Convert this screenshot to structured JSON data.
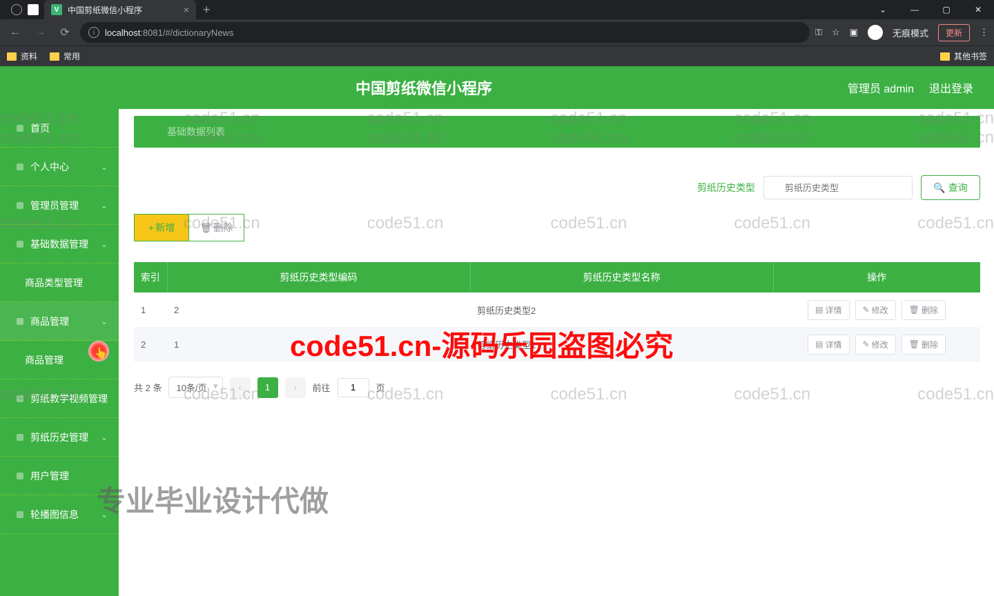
{
  "browser": {
    "tab_favicon": "V",
    "tab_title": "中国剪纸微信小程序",
    "url_host": "localhost",
    "url_rest": ":8081/#/dictionaryNews",
    "incognito": "无痕模式",
    "update": "更新",
    "bookmarks": {
      "b1": "资料",
      "b2": "常用",
      "other": "其他书签"
    },
    "win": {
      "min": "—",
      "max": "▢",
      "close": "✕",
      "dropdown": "⌄"
    }
  },
  "header": {
    "title": "中国剪纸微信小程序",
    "admin": "管理员 admin",
    "logout": "退出登录"
  },
  "sidebar": {
    "items": [
      {
        "label": "首页"
      },
      {
        "label": "个人中心",
        "chev": true
      },
      {
        "label": "管理员管理",
        "chev": true
      },
      {
        "label": "基础数据管理",
        "chev": true
      },
      {
        "label": "商品类型管理",
        "sub": true
      },
      {
        "label": "商品管理",
        "chev": true,
        "light": true
      },
      {
        "label": "商品管理",
        "sub": true,
        "active": true
      },
      {
        "label": "剪纸教学视频管理"
      },
      {
        "label": "剪纸历史管理",
        "chev": true
      },
      {
        "label": "用户管理"
      },
      {
        "label": "轮播图信息",
        "chev": true
      }
    ]
  },
  "content": {
    "breadcrumb": "基础数据列表",
    "search_label": "剪纸历史类型",
    "search_placeholder": "剪纸历史类型",
    "query": "查询",
    "add": "新增",
    "delete": "删除",
    "columns": {
      "idx": "索引",
      "code": "剪纸历史类型编码",
      "name": "剪纸历史类型名称",
      "ops": "操作"
    },
    "rows": [
      {
        "idx": "1",
        "code": "2",
        "name": "剪纸历史类型2"
      },
      {
        "idx": "2",
        "code": "1",
        "name": "剪纸历史类型1"
      }
    ],
    "row_ops": {
      "detail": "详情",
      "edit": "修改",
      "del": "删除"
    },
    "pagination": {
      "total": "共 2 条",
      "size": "10条/页",
      "page": "1",
      "goto_pre": "前往",
      "goto_val": "1",
      "goto_post": "页"
    }
  },
  "watermark": {
    "text": "code51.cn",
    "big": "code51.cn-源码乐园盗图必究",
    "bottom": "专业毕业设计代做"
  }
}
